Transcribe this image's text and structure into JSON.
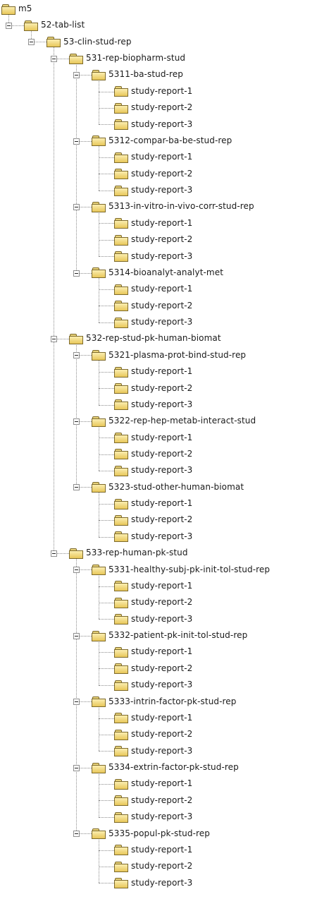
{
  "tree": {
    "label": "m5",
    "icon": "folder-icon",
    "expanded": true,
    "children": [
      {
        "label": "52-tab-list",
        "icon": "folder-icon",
        "expanded": true,
        "children": [
          {
            "label": "53-clin-stud-rep",
            "icon": "folder-icon",
            "expanded": true,
            "children": [
              {
                "label": "531-rep-biopharm-stud",
                "icon": "folder-icon",
                "expanded": true,
                "children": [
                  {
                    "label": "5311-ba-stud-rep",
                    "icon": "folder-icon",
                    "expanded": true,
                    "children": [
                      {
                        "label": "study-report-1",
                        "icon": "folder-icon"
                      },
                      {
                        "label": "study-report-2",
                        "icon": "folder-icon"
                      },
                      {
                        "label": "study-report-3",
                        "icon": "folder-icon"
                      }
                    ]
                  },
                  {
                    "label": "5312-compar-ba-be-stud-rep",
                    "icon": "folder-icon",
                    "expanded": true,
                    "children": [
                      {
                        "label": "study-report-1",
                        "icon": "folder-icon"
                      },
                      {
                        "label": "study-report-2",
                        "icon": "folder-icon"
                      },
                      {
                        "label": "study-report-3",
                        "icon": "folder-icon"
                      }
                    ]
                  },
                  {
                    "label": "5313-in-vitro-in-vivo-corr-stud-rep",
                    "icon": "folder-icon",
                    "expanded": true,
                    "children": [
                      {
                        "label": "study-report-1",
                        "icon": "folder-icon"
                      },
                      {
                        "label": "study-report-2",
                        "icon": "folder-icon"
                      },
                      {
                        "label": "study-report-3",
                        "icon": "folder-icon"
                      }
                    ]
                  },
                  {
                    "label": "5314-bioanalyt-analyt-met",
                    "icon": "folder-icon",
                    "expanded": true,
                    "children": [
                      {
                        "label": "study-report-1",
                        "icon": "folder-icon"
                      },
                      {
                        "label": "study-report-2",
                        "icon": "folder-icon"
                      },
                      {
                        "label": "study-report-3",
                        "icon": "folder-icon"
                      }
                    ]
                  }
                ]
              },
              {
                "label": "532-rep-stud-pk-human-biomat",
                "icon": "folder-icon",
                "expanded": true,
                "children": [
                  {
                    "label": "5321-plasma-prot-bind-stud-rep",
                    "icon": "folder-icon",
                    "expanded": true,
                    "children": [
                      {
                        "label": "study-report-1",
                        "icon": "folder-icon"
                      },
                      {
                        "label": "study-report-2",
                        "icon": "folder-icon"
                      },
                      {
                        "label": "study-report-3",
                        "icon": "folder-icon"
                      }
                    ]
                  },
                  {
                    "label": "5322-rep-hep-metab-interact-stud",
                    "icon": "folder-icon",
                    "expanded": true,
                    "children": [
                      {
                        "label": "study-report-1",
                        "icon": "folder-icon"
                      },
                      {
                        "label": "study-report-2",
                        "icon": "folder-icon"
                      },
                      {
                        "label": "study-report-3",
                        "icon": "folder-icon"
                      }
                    ]
                  },
                  {
                    "label": "5323-stud-other-human-biomat",
                    "icon": "folder-icon",
                    "expanded": true,
                    "children": [
                      {
                        "label": "study-report-1",
                        "icon": "folder-icon"
                      },
                      {
                        "label": "study-report-2",
                        "icon": "folder-icon"
                      },
                      {
                        "label": "study-report-3",
                        "icon": "folder-icon"
                      }
                    ]
                  }
                ]
              },
              {
                "label": "533-rep-human-pk-stud",
                "icon": "folder-icon",
                "expanded": true,
                "children": [
                  {
                    "label": "5331-healthy-subj-pk-init-tol-stud-rep",
                    "icon": "folder-icon",
                    "expanded": true,
                    "children": [
                      {
                        "label": "study-report-1",
                        "icon": "folder-icon"
                      },
                      {
                        "label": "study-report-2",
                        "icon": "folder-icon"
                      },
                      {
                        "label": "study-report-3",
                        "icon": "folder-icon"
                      }
                    ]
                  },
                  {
                    "label": "5332-patient-pk-init-tol-stud-rep",
                    "icon": "folder-icon",
                    "expanded": true,
                    "children": [
                      {
                        "label": "study-report-1",
                        "icon": "folder-icon"
                      },
                      {
                        "label": "study-report-2",
                        "icon": "folder-icon"
                      },
                      {
                        "label": "study-report-3",
                        "icon": "folder-icon"
                      }
                    ]
                  },
                  {
                    "label": "5333-intrin-factor-pk-stud-rep",
                    "icon": "folder-icon",
                    "expanded": true,
                    "children": [
                      {
                        "label": "study-report-1",
                        "icon": "folder-icon"
                      },
                      {
                        "label": "study-report-2",
                        "icon": "folder-icon"
                      },
                      {
                        "label": "study-report-3",
                        "icon": "folder-icon"
                      }
                    ]
                  },
                  {
                    "label": "5334-extrin-factor-pk-stud-rep",
                    "icon": "folder-icon",
                    "expanded": true,
                    "children": [
                      {
                        "label": "study-report-1",
                        "icon": "folder-icon"
                      },
                      {
                        "label": "study-report-2",
                        "icon": "folder-icon"
                      },
                      {
                        "label": "study-report-3",
                        "icon": "folder-icon"
                      }
                    ]
                  },
                  {
                    "label": "5335-popul-pk-stud-rep",
                    "icon": "folder-icon",
                    "expanded": true,
                    "children": [
                      {
                        "label": "study-report-1",
                        "icon": "folder-icon"
                      },
                      {
                        "label": "study-report-2",
                        "icon": "folder-icon"
                      },
                      {
                        "label": "study-report-3",
                        "icon": "folder-icon"
                      }
                    ]
                  }
                ]
              }
            ]
          }
        ]
      }
    ]
  }
}
